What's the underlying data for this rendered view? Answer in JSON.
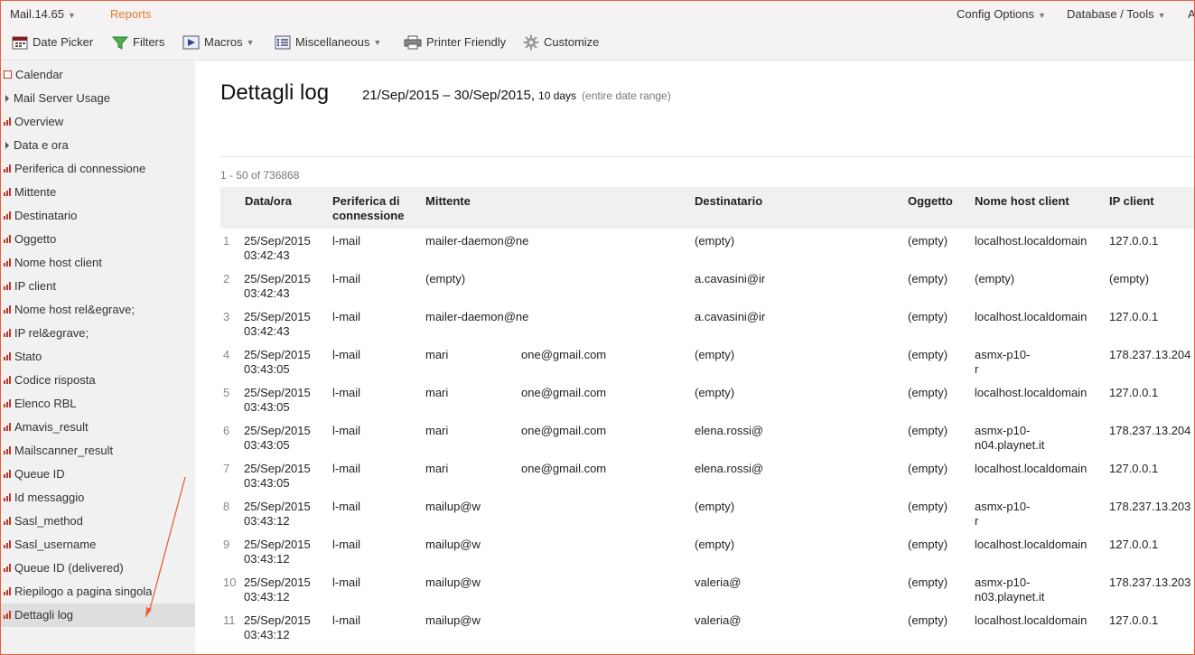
{
  "topbar": {
    "app_version": "Mail.14.65",
    "reports": "Reports",
    "config_options": "Config Options",
    "database_tools": "Database / Tools",
    "overflow_letter": "A"
  },
  "toolbar": {
    "date_picker": "Date Picker",
    "filters": "Filters",
    "macros": "Macros",
    "miscellaneous": "Miscellaneous",
    "printer_friendly": "Printer Friendly",
    "customize": "Customize"
  },
  "sidebar": {
    "items": [
      {
        "label": "Calendar",
        "icon": "calendar-icon"
      },
      {
        "label": "Mail Server Usage",
        "icon": "expand-triangle-icon"
      },
      {
        "label": "Overview",
        "icon": "report-bars-icon"
      },
      {
        "label": "Data e ora",
        "icon": "expand-triangle-icon"
      },
      {
        "label": "Periferica di connessione",
        "icon": "report-bars-icon"
      },
      {
        "label": "Mittente",
        "icon": "report-bars-icon"
      },
      {
        "label": "Destinatario",
        "icon": "report-bars-icon"
      },
      {
        "label": "Oggetto",
        "icon": "report-bars-icon"
      },
      {
        "label": "Nome host client",
        "icon": "report-bars-icon"
      },
      {
        "label": "IP client",
        "icon": "report-bars-icon"
      },
      {
        "label": "Nome host rel&egrave;",
        "icon": "report-bars-icon"
      },
      {
        "label": "IP rel&egrave;",
        "icon": "report-bars-icon"
      },
      {
        "label": "Stato",
        "icon": "report-bars-icon"
      },
      {
        "label": "Codice risposta",
        "icon": "report-bars-icon"
      },
      {
        "label": "Elenco RBL",
        "icon": "report-bars-icon"
      },
      {
        "label": "Amavis_result",
        "icon": "report-bars-icon"
      },
      {
        "label": "Mailscanner_result",
        "icon": "report-bars-icon"
      },
      {
        "label": "Queue ID",
        "icon": "report-bars-icon"
      },
      {
        "label": "Id messaggio",
        "icon": "report-bars-icon"
      },
      {
        "label": "Sasl_method",
        "icon": "report-bars-icon"
      },
      {
        "label": "Sasl_username",
        "icon": "report-bars-icon"
      },
      {
        "label": "Queue ID (delivered)",
        "icon": "report-bars-icon"
      },
      {
        "label": "Riepilogo a pagina singola",
        "icon": "report-bars-icon"
      },
      {
        "label": "Dettagli log",
        "icon": "report-bars-icon",
        "active": true
      }
    ]
  },
  "main": {
    "title": "Dettagli log",
    "date_range": "21/Sep/2015 – 30/Sep/2015,",
    "days": "10 days",
    "entire": "(entire date range)",
    "count": "1 - 50 of 736868"
  },
  "table": {
    "headers": {
      "date": "Data/ora",
      "device_line1": "Periferica di",
      "device_line2": "connessione",
      "sender": "Mittente",
      "recipient": "Destinatario",
      "subject": "Oggetto",
      "host": "Nome host client",
      "ip": "IP client"
    },
    "rows": [
      {
        "n": "1",
        "date": "25/Sep/2015",
        "time": "03:42:43",
        "device": "l-mail",
        "sender": "mailer-daemon@ne",
        "sender2": "",
        "recipient": "(empty)",
        "subject": "(empty)",
        "host": "localhost.localdomain",
        "host2": "",
        "ip": "127.0.0.1"
      },
      {
        "n": "2",
        "date": "25/Sep/2015",
        "time": "03:42:43",
        "device": "l-mail",
        "sender": "(empty)",
        "sender2": "",
        "recipient": "a.cavasini@ir",
        "subject": "(empty)",
        "host": "(empty)",
        "host2": "",
        "ip": "(empty)"
      },
      {
        "n": "3",
        "date": "25/Sep/2015",
        "time": "03:42:43",
        "device": "l-mail",
        "sender": "mailer-daemon@ne",
        "sender2": "",
        "recipient": "a.cavasini@ir",
        "subject": "(empty)",
        "host": "localhost.localdomain",
        "host2": "",
        "ip": "127.0.0.1"
      },
      {
        "n": "4",
        "date": "25/Sep/2015",
        "time": "03:43:05",
        "device": "l-mail",
        "sender": "mari",
        "sender2": "one@gmail.com",
        "recipient": "(empty)",
        "subject": "(empty)",
        "host": "asmx-p10-",
        "host2": "r",
        "ip": "178.237.13.204"
      },
      {
        "n": "5",
        "date": "25/Sep/2015",
        "time": "03:43:05",
        "device": "l-mail",
        "sender": "mari",
        "sender2": "one@gmail.com",
        "recipient": "(empty)",
        "subject": "(empty)",
        "host": "localhost.localdomain",
        "host2": "",
        "ip": "127.0.0.1"
      },
      {
        "n": "6",
        "date": "25/Sep/2015",
        "time": "03:43:05",
        "device": "l-mail",
        "sender": "mari",
        "sender2": "one@gmail.com",
        "recipient": "elena.rossi@",
        "subject": "(empty)",
        "host": "asmx-p10-",
        "host2": "n04.playnet.it",
        "ip": "178.237.13.204"
      },
      {
        "n": "7",
        "date": "25/Sep/2015",
        "time": "03:43:05",
        "device": "l-mail",
        "sender": "mari",
        "sender2": "one@gmail.com",
        "recipient": "elena.rossi@",
        "subject": "(empty)",
        "host": "localhost.localdomain",
        "host2": "",
        "ip": "127.0.0.1"
      },
      {
        "n": "8",
        "date": "25/Sep/2015",
        "time": "03:43:12",
        "device": "l-mail",
        "sender": "mailup@w",
        "sender2": "",
        "recipient": "(empty)",
        "subject": "(empty)",
        "host": "asmx-p10-",
        "host2": "r",
        "ip": "178.237.13.203"
      },
      {
        "n": "9",
        "date": "25/Sep/2015",
        "time": "03:43:12",
        "device": "l-mail",
        "sender": "mailup@w",
        "sender2": "",
        "recipient": "(empty)",
        "subject": "(empty)",
        "host": "localhost.localdomain",
        "host2": "",
        "ip": "127.0.0.1"
      },
      {
        "n": "10",
        "date": "25/Sep/2015",
        "time": "03:43:12",
        "device": "l-mail",
        "sender": "mailup@w",
        "sender2": "",
        "recipient": "valeria@",
        "subject": "(empty)",
        "host": "asmx-p10-",
        "host2": "n03.playnet.it",
        "ip": "178.237.13.203"
      },
      {
        "n": "11",
        "date": "25/Sep/2015",
        "time": "03:43:12",
        "device": "l-mail",
        "sender": "mailup@w",
        "sender2": "",
        "recipient": "valeria@",
        "subject": "(empty)",
        "host": "localhost.localdomain",
        "host2": "",
        "ip": "127.0.0.1"
      }
    ]
  },
  "colors": {
    "accent_orange": "#e27b2b",
    "annotation_arrow": "#e8603c",
    "icon_red": "#c0392b"
  }
}
